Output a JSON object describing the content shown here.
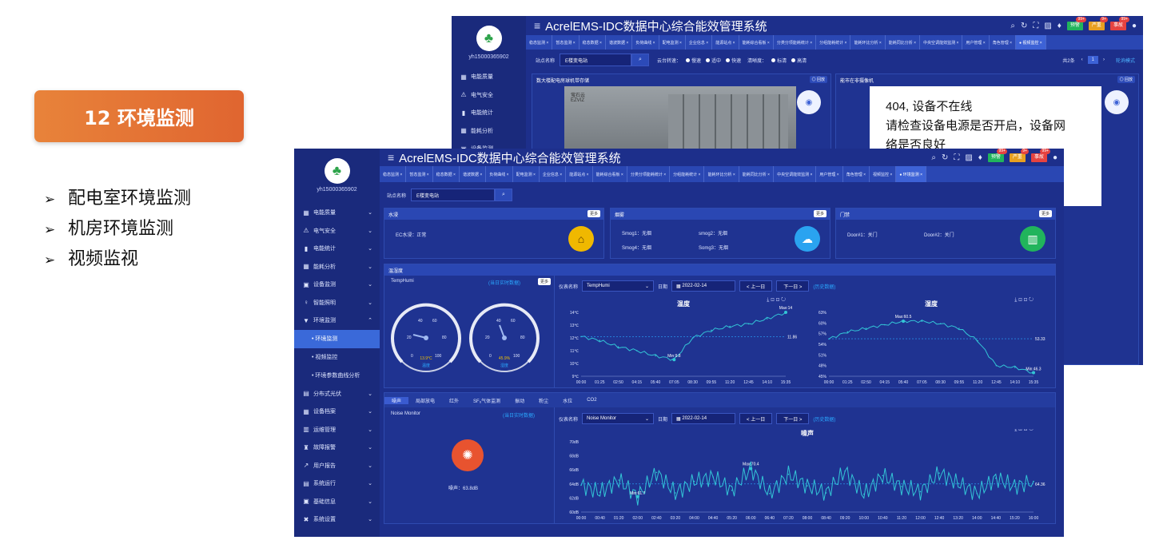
{
  "slide": {
    "heading": "12 环境监测",
    "bullets": [
      "配电室环境监测",
      "机房环境监测",
      "视频监视"
    ]
  },
  "app": {
    "title": "AcrelEMS-IDC数据中心综合能效管理系统",
    "user": "yh15000365902",
    "header_badges": [
      {
        "label": "预警",
        "count": "99+",
        "color": "#21b45c"
      },
      {
        "label": "严重",
        "count": "9+",
        "color": "#e8a020"
      },
      {
        "label": "事故",
        "count": "99+",
        "color": "#e64340"
      }
    ]
  },
  "back_window": {
    "tabs": [
      "稳态监测 ×",
      "暂态监测 ×",
      "稳态数据 ×",
      "谐波数据 ×",
      "负荷曲线 ×",
      "配电监测 ×",
      "企业信息 ×",
      "能源站点 ×",
      "能耗综合看板 ×",
      "分类分项能耗统计 ×",
      "分组能耗统计 ×",
      "能耗环比分析 ×",
      "能耗同比分析 ×",
      "中央空调能效监测 ×",
      "用户管理 ×",
      "角色管理 ×",
      "● 视频监控 ×"
    ],
    "menu": [
      {
        "icon": "▦",
        "label": "电能质量"
      },
      {
        "icon": "⚠",
        "label": "电气安全"
      },
      {
        "icon": "▮",
        "label": "电能统计"
      },
      {
        "icon": "▦",
        "label": "能耗分析"
      },
      {
        "icon": "▣",
        "label": "设备监测"
      }
    ],
    "filter": {
      "station_label": "站点名称",
      "station_value": "E楼变电站",
      "ptz_label": "云台转速：",
      "ptz_options": [
        "慢速",
        "适中",
        "快速"
      ],
      "clarity_label": "清晰度：",
      "clarity_options": [
        "标清",
        "高清"
      ],
      "pager": "共2条",
      "page": "1",
      "mode": "轮询模式"
    },
    "cam1_title": "数大楼配电房球机带存储",
    "cam2_title": "能市在非摄像机",
    "back_btn": "◎ 回放",
    "cam_brand": "萤石云",
    "cam_brand_sub": "EZVIZ",
    "error_lines": [
      "404, 设备不在线",
      "请检查设备电源是否开启，设备网",
      "络是否良好"
    ]
  },
  "front_window": {
    "tabs": [
      "稳态监测 ×",
      "暂态监测 ×",
      "稳态数据 ×",
      "谐波数据 ×",
      "负荷曲线 ×",
      "配电监测 ×",
      "企业信息 ×",
      "能源站点 ×",
      "能耗综合看板 ×",
      "分类分项能耗统计 ×",
      "分组能耗统计 ×",
      "能耗环比分析 ×",
      "能耗同比分析 ×",
      "中央空调能效监测 ×",
      "用户管理 ×",
      "角色管理 ×",
      "视频监控 ×",
      "● 环境监测 ×"
    ],
    "menu": [
      {
        "icon": "▦",
        "label": "电能质量",
        "chev": "⌄"
      },
      {
        "icon": "⚠",
        "label": "电气安全",
        "chev": "⌄"
      },
      {
        "icon": "▮",
        "label": "电能统计",
        "chev": "⌄"
      },
      {
        "icon": "▦",
        "label": "能耗分析",
        "chev": "⌄"
      },
      {
        "icon": "▣",
        "label": "设备监测",
        "chev": "⌄"
      },
      {
        "icon": "♀",
        "label": "智能照明",
        "chev": "⌄"
      },
      {
        "icon": "▼",
        "label": "环境监测",
        "chev": "⌃"
      }
    ],
    "submenu": [
      "• 环境监测",
      "• 视频监控",
      "• 环境参数曲线分析"
    ],
    "menu2": [
      {
        "icon": "▤",
        "label": "分布式光伏",
        "chev": "⌄"
      },
      {
        "icon": "▦",
        "label": "设备档案",
        "chev": "⌄"
      },
      {
        "icon": "▥",
        "label": "运维管理",
        "chev": "⌄"
      },
      {
        "icon": "♜",
        "label": "故障报警",
        "chev": "⌄"
      },
      {
        "icon": "↗",
        "label": "用户报告",
        "chev": "⌄"
      },
      {
        "icon": "▤",
        "label": "系统运行",
        "chev": "⌄"
      },
      {
        "icon": "▣",
        "label": "基础信息",
        "chev": "⌄"
      },
      {
        "icon": "✖",
        "label": "系统设置",
        "chev": "⌄"
      }
    ],
    "station_label": "站点名称",
    "station_value": "E楼变电站",
    "more": "更多",
    "water": {
      "title": "水浸",
      "item": "EC水浸：正常"
    },
    "smoke": {
      "title": "烟雾",
      "items": [
        "Smog1：无烟",
        "smog2：无烟",
        "Smog4：无烟",
        "Somg3：无烟"
      ]
    },
    "door": {
      "title": "门禁",
      "items": [
        "Door#1：关门",
        "Door#2：关门"
      ]
    },
    "temphumi": {
      "section": "温湿度",
      "device": "TempHumi",
      "realtime": "(当日实时数据)",
      "temp_reading": "13.9°C",
      "temp_label": "温度",
      "hum_reading": "45.9%",
      "hum_label": "湿度",
      "meter_label": "仪表名称",
      "meter_value": "TempHumi",
      "date_label": "日期",
      "date_value": "2022-02-14",
      "prev": "< 上一日",
      "next": "下一日 >",
      "history": "(历史数据)"
    },
    "temp_chart_title": "温度",
    "hum_chart_title": "湿度",
    "noise": {
      "tabs": [
        "噪声",
        "局部放电",
        "红外",
        "SF₆气体监测",
        "振动",
        "粉尘",
        "水位",
        "CO2"
      ],
      "device": "Noise Monitor",
      "realtime": "(当日实时数据)",
      "reading": "噪声：63.8dB",
      "meter_label": "仪表名称",
      "meter_value": "Noise Monitor",
      "date_label": "日期",
      "date_value": "2022-02-14",
      "prev": "< 上一日",
      "next": "下一日 >",
      "history": "(历史数据)",
      "chart_title": "噪声"
    }
  },
  "chart_data": [
    {
      "type": "line",
      "title": "温度",
      "x": [
        "00:00",
        "01:25",
        "02:50",
        "04:15",
        "05:40",
        "07:05",
        "08:30",
        "09:55",
        "11:20",
        "12:45",
        "14:10",
        "15:35"
      ],
      "y_ticks": [
        "9℃",
        "10℃",
        "11℃",
        "12℃",
        "13℃",
        "14℃"
      ],
      "ylim": [
        9,
        14
      ],
      "series": [
        {
          "values": [
            12.1,
            11.8,
            11.3,
            11.0,
            10.6,
            10.3,
            12.0,
            12.6,
            12.9,
            13.1,
            13.5,
            14.0
          ]
        }
      ],
      "annotations": {
        "max": "Max:14",
        "min": "Min:9.8",
        "avg": "11.86"
      }
    },
    {
      "type": "line",
      "title": "湿度",
      "x": [
        "00:00",
        "01:25",
        "02:50",
        "04:15",
        "05:40",
        "07:05",
        "08:30",
        "09:55",
        "11:20",
        "12:45",
        "14:10",
        "15:35"
      ],
      "y_ticks": [
        "45%",
        "48%",
        "51%",
        "54%",
        "57%",
        "60%",
        "63%"
      ],
      "ylim": [
        45,
        63
      ],
      "series": [
        {
          "values": [
            55.5,
            57.5,
            58.5,
            59.5,
            60.5,
            60.5,
            59.8,
            58.5,
            55.0,
            48.0,
            47.5,
            46.0
          ]
        }
      ],
      "annotations": {
        "max": "Max:60.5",
        "min": "Min:46.3",
        "avg": "53.33"
      }
    },
    {
      "type": "line",
      "title": "噪声",
      "x": [
        "00:00",
        "00:40",
        "01:20",
        "02:00",
        "02:40",
        "03:20",
        "04:00",
        "04:40",
        "05:20",
        "06:00",
        "06:40",
        "07:20",
        "08:00",
        "08:40",
        "09:20",
        "10:00",
        "10:40",
        "11:20",
        "12:00",
        "12:40",
        "13:20",
        "14:00",
        "14:40",
        "15:20",
        "16:00"
      ],
      "y_ticks": [
        "60dB",
        "62dB",
        "64dB",
        "66dB",
        "68dB",
        "70dB"
      ],
      "ylim": [
        60,
        71
      ],
      "series": [
        {
          "values": [
            64.2,
            63.1,
            65.0,
            62.4,
            66.2,
            63.0,
            64.8,
            65.5,
            63.4,
            66.8,
            62.9,
            65.9,
            64.1,
            63.0,
            66.4,
            62.8,
            65.7,
            64.0,
            63.2,
            66.1,
            64.5,
            62.9,
            65.3,
            64.0,
            64.8
          ]
        }
      ],
      "annotations": {
        "max": "Max:70.4",
        "min": "Min:61.7",
        "avg": "64.36"
      }
    }
  ]
}
